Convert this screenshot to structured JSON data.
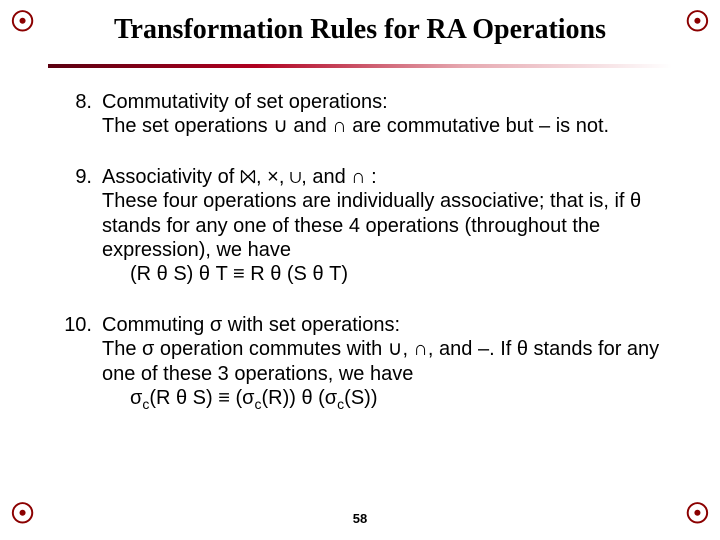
{
  "title": "Transformation Rules for RA Operations",
  "corner_glyph": "☉",
  "accent_color": "#8b0000",
  "page_number": "58",
  "items": [
    {
      "num": "8.",
      "heading": "Commutativity of set operations:",
      "text": "The set operations ∪ and ∩ are commutative but – is not."
    },
    {
      "num": "9.",
      "heading": "Associativity of ⨝, ×, ∪, and ∩ :",
      "text": "These four operations are individually associative; that is, if θ stands for any one of these 4 operations (throughout the expression), we have",
      "formula": "(R θ S) θ T ≡ R θ (S θ T)"
    },
    {
      "num": "10.",
      "heading": "Commuting σ with set operations:",
      "text": "The σ operation commutes with ∪, ∩, and –. If θ stands for any one of these 3 operations, we have",
      "formula": "σ_c(R θ S) ≡ (σ_c(R)) θ (σ_c(S))"
    }
  ]
}
